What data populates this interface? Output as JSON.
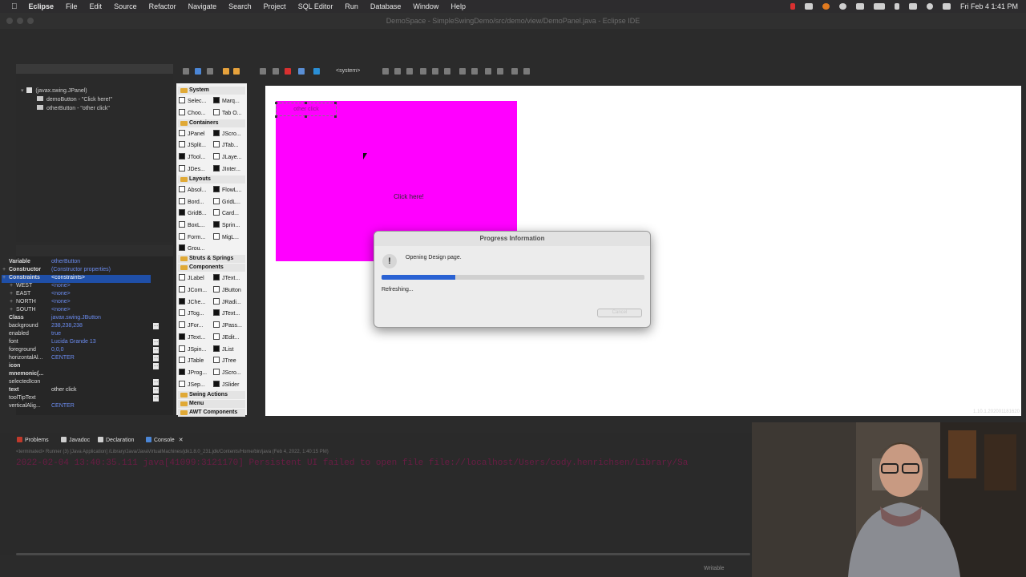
{
  "menubar": {
    "app_name": "Eclipse",
    "items": [
      "File",
      "Edit",
      "Source",
      "Refactor",
      "Navigate",
      "Search",
      "Project",
      "SQL Editor",
      "Run",
      "Database",
      "Window",
      "Help"
    ],
    "clock": "Fri Feb 4  1:41 PM"
  },
  "window": {
    "title": "DemoSpace - SimpleSwingDemo/src/demo/view/DemoPanel.java - Eclipse IDE"
  },
  "structure": {
    "items": [
      "(javax.swing.JPanel)",
      "demoButton - \"Click here!\"",
      "otherButton - \"other click\""
    ]
  },
  "properties": {
    "rows": [
      {
        "key": "Variable",
        "value": "otherButton",
        "bold": true
      },
      {
        "key": "Constructor",
        "value": "(Constructor properties)",
        "bold": true,
        "plus": true
      },
      {
        "key": "Constraints",
        "value": "<constraints>",
        "bold": true,
        "plus": true,
        "selected": true
      },
      {
        "key": "WEST",
        "value": "<none>",
        "plus": true,
        "indent": true
      },
      {
        "key": "EAST",
        "value": "<none>",
        "plus": true,
        "indent": true
      },
      {
        "key": "NORTH",
        "value": "<none>",
        "plus": true,
        "indent": true
      },
      {
        "key": "SOUTH",
        "value": "<none>",
        "plus": true,
        "indent": true
      },
      {
        "key": "Class",
        "value": "javax.swing.JButton",
        "bold": true
      },
      {
        "key": "background",
        "value": "238,238,238"
      },
      {
        "key": "enabled",
        "value": "true"
      },
      {
        "key": "font",
        "value": "Lucida Grande 13"
      },
      {
        "key": "foreground",
        "value": "0,0,0"
      },
      {
        "key": "horizontalAl...",
        "value": "CENTER"
      },
      {
        "key": "icon",
        "value": "",
        "bold": true
      },
      {
        "key": "mnemonic(...",
        "value": "",
        "bold": true
      },
      {
        "key": "selectedIcon",
        "value": ""
      },
      {
        "key": "text",
        "value": "other click",
        "bold": true,
        "white": true
      },
      {
        "key": "toolTipText",
        "value": ""
      },
      {
        "key": "verticalAlig...",
        "value": "CENTER"
      }
    ]
  },
  "palette": {
    "categories": [
      {
        "label": "System",
        "items": [
          "Selec...",
          "Marq...",
          "Choo...",
          "Tab O..."
        ]
      },
      {
        "label": "Containers",
        "items": [
          "JPanel",
          "JScro...",
          "JSplit...",
          "JTab...",
          "JTool...",
          "JLaye...",
          "JDes...",
          "JInter..."
        ]
      },
      {
        "label": "Layouts",
        "items": [
          "Absol...",
          "FlowL...",
          "Bord...",
          "GridL...",
          "GridB...",
          "Card...",
          "BoxL...",
          "Sprin...",
          "Form...",
          "MigL...",
          "Grou..."
        ]
      },
      {
        "label": "Struts & Springs",
        "items": []
      },
      {
        "label": "Components",
        "items": [
          "JLabel",
          "JText...",
          "JCom...",
          "JButton",
          "JChe...",
          "JRadi...",
          "JTog...",
          "JText...",
          "JFor...",
          "JPass...",
          "JText...",
          "JEdit...",
          "JSpin...",
          "JList",
          "JTable",
          "JTree",
          "JProg...",
          "JScro...",
          "JSep...",
          "JSlider"
        ]
      },
      {
        "label": "Swing Actions",
        "items": []
      },
      {
        "label": "Menu",
        "items": []
      },
      {
        "label": "AWT Components",
        "items": []
      }
    ]
  },
  "design": {
    "toolbar_system": "<system>",
    "other_button": "other click",
    "demo_button": "Click here!",
    "version": "1.10.1.202001181620",
    "panel_color": "#ff00ff"
  },
  "dialog": {
    "title": "Progress Information",
    "message": "Opening Design page.",
    "progress": 0.28,
    "subtask": "Refreshing...",
    "cancel": "Cancel"
  },
  "bottom": {
    "tabs": [
      "Problems",
      "Javadoc",
      "Declaration",
      "Console"
    ],
    "console_path": "<terminated> Runner (3) [Java Application] /Library/Java/JavaVirtualMachines/jdk1.8.0_231.jdk/Contents/Home/bin/java (Feb 4, 2022, 1:40:15 PM)",
    "console_error": "2022-02-04 13:40:35.111 java[41099:3121170] Persistent UI failed to open file file://localhost/Users/cody.henrichsen/Library/Sa",
    "status_writable": "Writable"
  }
}
